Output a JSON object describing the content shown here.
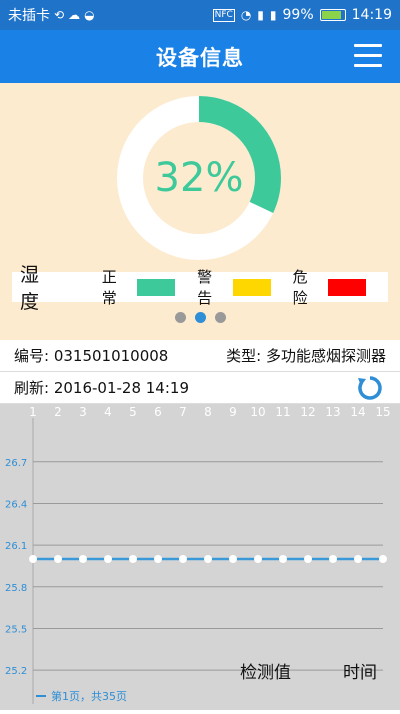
{
  "status_bar": {
    "carrier": "未插卡",
    "battery_pct": "99%",
    "time": "14:19",
    "battery_level": 0.99
  },
  "app_bar": {
    "title": "设备信息"
  },
  "gauge": {
    "value_text": "32%",
    "value_fraction": 0.32,
    "colors": {
      "filled": "#3ec99a",
      "track": "#ffffff"
    }
  },
  "legend": {
    "label": "湿度",
    "items": [
      {
        "name": "正常",
        "color": "#3ec99a"
      },
      {
        "name": "警告",
        "color": "#ffd700"
      },
      {
        "name": "危险",
        "color": "#ff0000"
      }
    ]
  },
  "pager": {
    "count": 3,
    "active_index": 1
  },
  "device": {
    "id_text": "编号: 031501010008",
    "type_text": "类型: 多功能感烟探测器",
    "refresh_text": "刷新: 2016-01-28 14:19"
  },
  "chart_data": {
    "type": "line",
    "x": [
      1,
      2,
      3,
      4,
      5,
      6,
      7,
      8,
      9,
      10,
      11,
      12,
      13,
      14,
      15
    ],
    "series": [
      {
        "name": "",
        "values": [
          26.0,
          26.0,
          26.0,
          26.0,
          26.0,
          26.0,
          26.0,
          26.0,
          26.0,
          26.0,
          26.0,
          26.0,
          26.0,
          26.0,
          26.0
        ]
      }
    ],
    "y_ticks": [
      25.2,
      25.5,
      25.8,
      26.1,
      26.4,
      26.7
    ],
    "ylim": [
      25.1,
      26.9
    ],
    "xlabel": "时间",
    "ylabel": "检测值",
    "legend_text": "第1页，共35页",
    "grid": true,
    "line_color": "#3a9ad9"
  }
}
